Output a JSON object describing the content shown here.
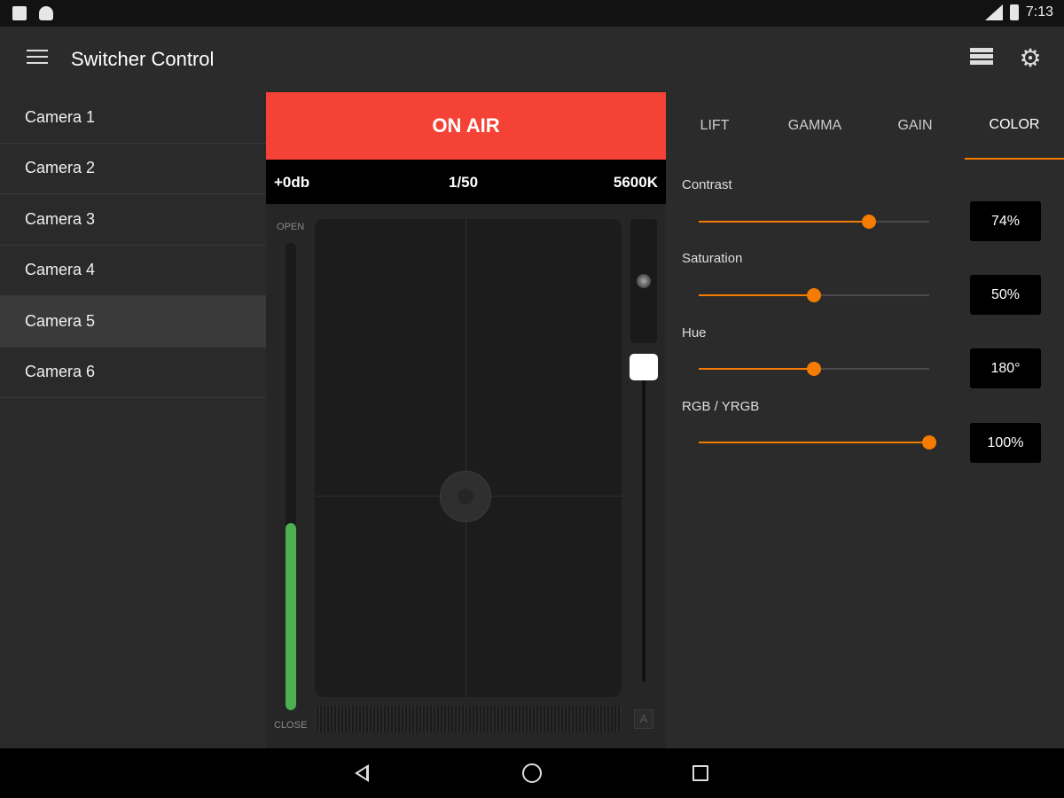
{
  "status_bar": {
    "time": "7:13",
    "icons": [
      "notification-icon",
      "android-icon",
      "signal-icon",
      "battery-icon"
    ]
  },
  "app_bar": {
    "title": "Switcher Control",
    "icons": [
      "menu-icon",
      "list-icon",
      "gear-icon"
    ]
  },
  "sidebar": {
    "items": [
      {
        "label": "Camera 1",
        "selected": false
      },
      {
        "label": "Camera 2",
        "selected": false
      },
      {
        "label": "Camera 3",
        "selected": false
      },
      {
        "label": "Camera 4",
        "selected": false
      },
      {
        "label": "Camera 5",
        "selected": true
      },
      {
        "label": "Camera 6",
        "selected": false
      }
    ]
  },
  "center": {
    "on_air_label": "ON AIR",
    "gain": "+0db",
    "shutter": "1/50",
    "white_balance": "5600K",
    "iris": {
      "open_label": "OPEN",
      "close_label": "CLOSE",
      "level": 0.4
    },
    "auto_button_label": "A"
  },
  "right": {
    "tabs": [
      {
        "label": "LIFT",
        "active": false
      },
      {
        "label": "GAMMA",
        "active": false
      },
      {
        "label": "GAIN",
        "active": false
      },
      {
        "label": "COLOR",
        "active": true
      }
    ],
    "controls": [
      {
        "label": "Contrast",
        "value_text": "74%",
        "level": 0.74
      },
      {
        "label": "Saturation",
        "value_text": "50%",
        "level": 0.5
      },
      {
        "label": "Hue",
        "value_text": "180°",
        "level": 0.5
      },
      {
        "label": "RGB / YRGB",
        "value_text": "100%",
        "level": 1.0
      }
    ]
  },
  "colors": {
    "on_air": "#f44336",
    "accent": "#f57c00",
    "iris_level": "#4caf50"
  },
  "nav_bar": {
    "icons": [
      "back-icon",
      "home-icon",
      "recents-icon"
    ]
  }
}
